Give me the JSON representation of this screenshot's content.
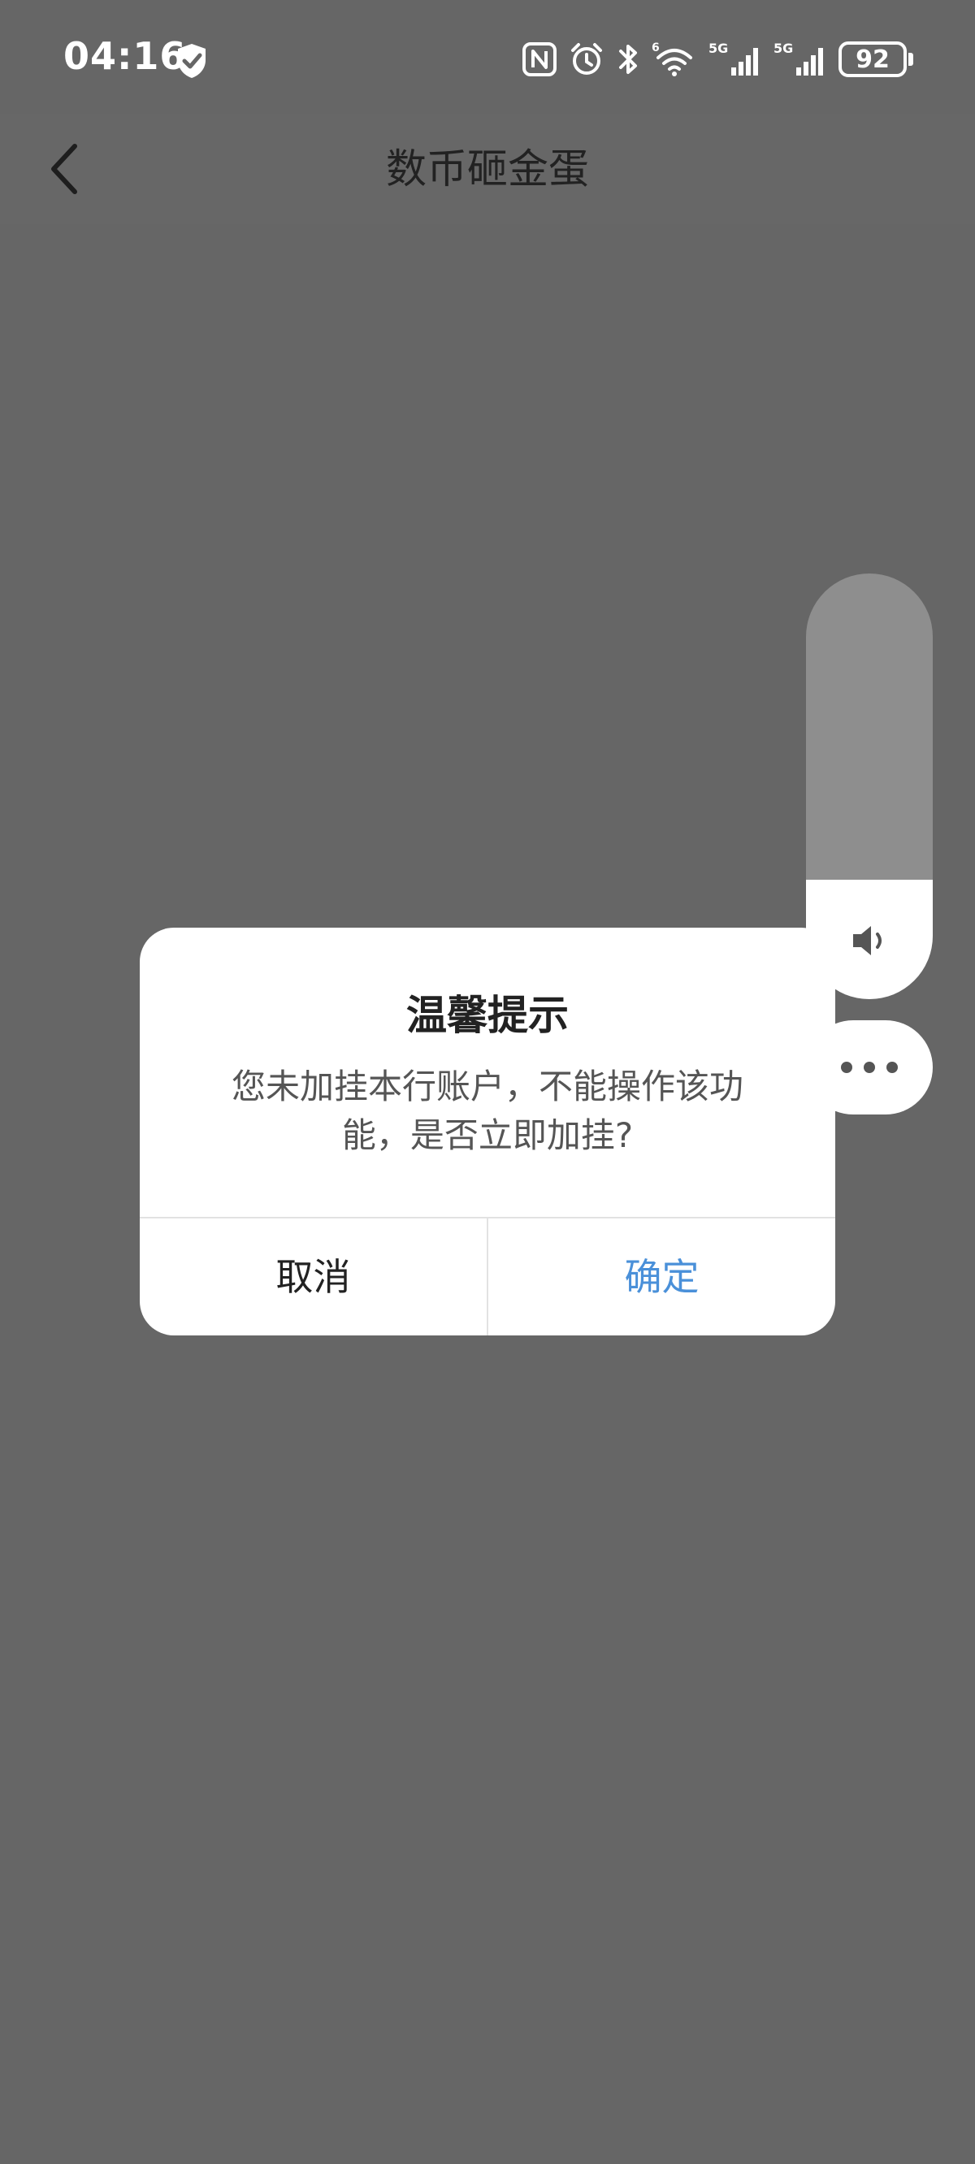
{
  "status_bar": {
    "time": "04:16",
    "battery_level": "92",
    "icons": [
      "shield-check-icon",
      "nfc-icon",
      "alarm-icon",
      "bluetooth-icon",
      "wifi-6-icon",
      "5g-signal-icon",
      "5g-signal-icon",
      "battery-icon"
    ]
  },
  "nav": {
    "back_icon": "chevron-left-icon",
    "title": "数币砸金蛋"
  },
  "dialog": {
    "title": "温馨提示",
    "message": "您未加挂本行账户，不能操作该功能，是否立即加挂?",
    "cancel_label": "取消",
    "confirm_label": "确定",
    "confirm_color": "#4a90d9"
  },
  "volume": {
    "icon": "speaker-icon",
    "level": 0.28
  },
  "more_button": {
    "icon": "more-dots-icon"
  },
  "colors": {
    "overlay_background": "#666666",
    "dialog_background": "#ffffff"
  }
}
